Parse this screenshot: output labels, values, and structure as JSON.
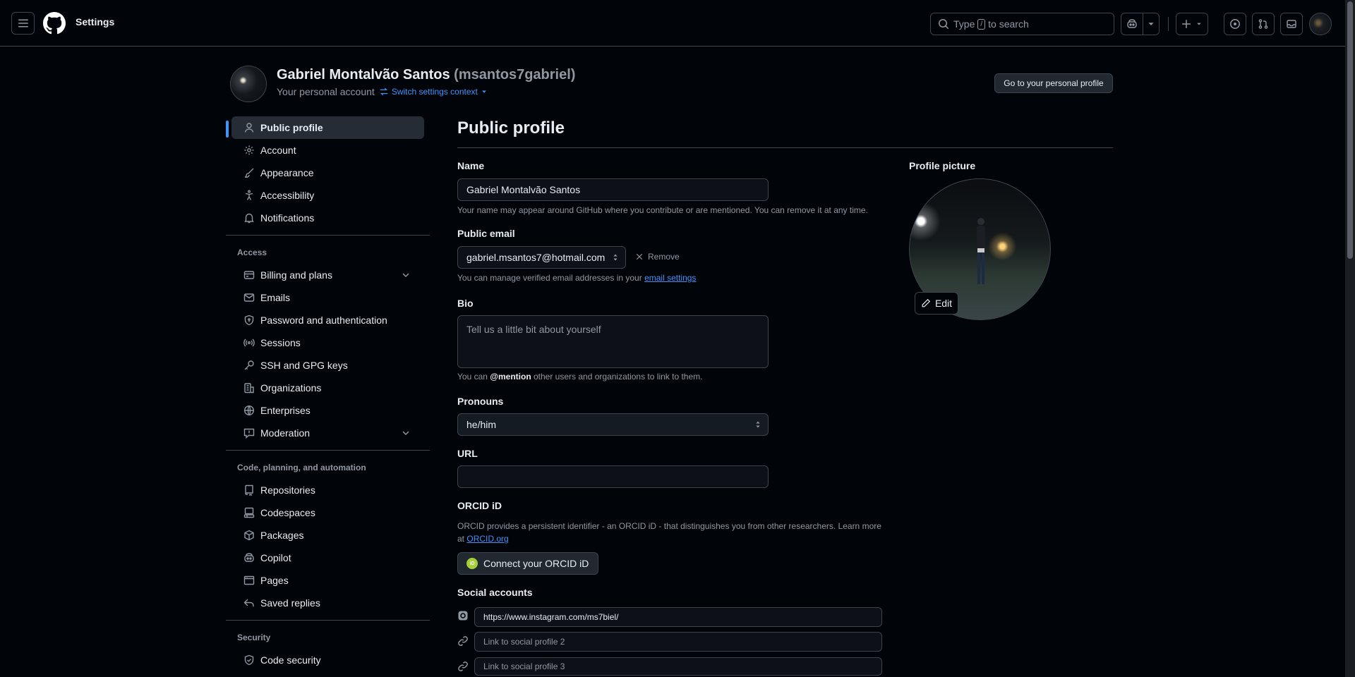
{
  "topbar": {
    "title": "Settings",
    "search_prefix": "Type",
    "search_key": "/",
    "search_suffix": "to search"
  },
  "header": {
    "name": "Gabriel Montalvão Santos",
    "login": "(msantos7gabriel)",
    "subtitle": "Your personal account",
    "switch_label": "Switch settings context",
    "go_profile_button": "Go to your personal profile"
  },
  "sidebar": {
    "top_items": [
      {
        "label": "Public profile",
        "icon": "person-icon",
        "active": true
      },
      {
        "label": "Account",
        "icon": "gear-icon"
      },
      {
        "label": "Appearance",
        "icon": "paintbrush-icon"
      },
      {
        "label": "Accessibility",
        "icon": "accessibility-icon"
      },
      {
        "label": "Notifications",
        "icon": "bell-icon"
      }
    ],
    "access_heading": "Access",
    "access_items": [
      {
        "label": "Billing and plans",
        "icon": "credit-card-icon",
        "expandable": true
      },
      {
        "label": "Emails",
        "icon": "mail-icon"
      },
      {
        "label": "Password and authentication",
        "icon": "shield-lock-icon"
      },
      {
        "label": "Sessions",
        "icon": "broadcast-icon"
      },
      {
        "label": "SSH and GPG keys",
        "icon": "key-icon"
      },
      {
        "label": "Organizations",
        "icon": "organization-icon"
      },
      {
        "label": "Enterprises",
        "icon": "globe-icon"
      },
      {
        "label": "Moderation",
        "icon": "report-icon",
        "expandable": true
      }
    ],
    "code_heading": "Code, planning, and automation",
    "code_items": [
      {
        "label": "Repositories",
        "icon": "repo-icon"
      },
      {
        "label": "Codespaces",
        "icon": "codespaces-icon"
      },
      {
        "label": "Packages",
        "icon": "package-icon"
      },
      {
        "label": "Copilot",
        "icon": "copilot-icon"
      },
      {
        "label": "Pages",
        "icon": "browser-icon"
      },
      {
        "label": "Saved replies",
        "icon": "reply-icon"
      }
    ],
    "security_heading": "Security",
    "security_items": [
      {
        "label": "Code security",
        "icon": "shield-check-icon"
      }
    ]
  },
  "main": {
    "title": "Public profile",
    "name_label": "Name",
    "name_value": "Gabriel Montalvão Santos",
    "name_note": "Your name may appear around GitHub where you contribute or are mentioned. You can remove it at any time.",
    "email_label": "Public email",
    "email_value": "gabriel.msantos7@hotmail.com",
    "email_remove": "Remove",
    "email_note_prefix": "You can manage verified email addresses in your",
    "email_note_link": "email settings",
    "bio_label": "Bio",
    "bio_placeholder": "Tell us a little bit about yourself",
    "bio_note_prefix": "You can",
    "bio_note_bold": "@mention",
    "bio_note_suffix": "other users and organizations to link to them.",
    "pronouns_label": "Pronouns",
    "pronouns_value": "he/him",
    "url_label": "URL",
    "url_value": "",
    "orcid_label": "ORCID iD",
    "orcid_note_prefix": "ORCID provides a persistent identifier - an ORCID iD - that distinguishes you from other researchers. Learn more at",
    "orcid_note_link": "ORCID.org",
    "orcid_button": "Connect your ORCID iD",
    "orcid_badge": "iD",
    "social_label": "Social accounts",
    "social": [
      {
        "value": "https://www.instagram.com/ms7biel/",
        "placeholder": "",
        "icon": "instagram-icon"
      },
      {
        "value": "",
        "placeholder": "Link to social profile 2",
        "icon": "link-icon"
      },
      {
        "value": "",
        "placeholder": "Link to social profile 3",
        "icon": "link-icon"
      }
    ],
    "profile_picture_label": "Profile picture",
    "edit_button": "Edit"
  }
}
